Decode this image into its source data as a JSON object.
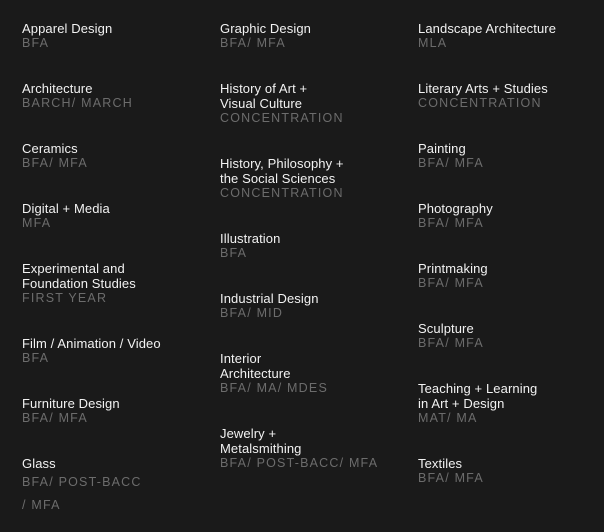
{
  "programs": {
    "col1": [
      {
        "name": "Apparel Design",
        "degree": "BFA"
      },
      {
        "name": "Architecture",
        "degree": "BARCH/ MARCH"
      },
      {
        "name": "Ceramics",
        "degree": "BFA/ MFA"
      },
      {
        "name": "Digital + Media",
        "degree": "MFA"
      },
      {
        "name": "Experimental and\nFoundation Studies",
        "degree": "FIRST YEAR"
      },
      {
        "name": "Film / Animation / Video",
        "degree": "BFA"
      },
      {
        "name": "Furniture Design",
        "degree": "BFA/ MFA"
      },
      {
        "name": "Glass",
        "degree": "BFA/ POST-BACC\n/ MFA"
      }
    ],
    "col2": [
      {
        "name": "Graphic Design",
        "degree": "BFA/ MFA"
      },
      {
        "name": "History of Art +\nVisual Culture",
        "degree": "CONCENTRATION"
      },
      {
        "name": "History, Philosophy +\nthe Social Sciences",
        "degree": "CONCENTRATION"
      },
      {
        "name": "Illustration",
        "degree": "BFA"
      },
      {
        "name": "Industrial Design",
        "degree": "BFA/ MID"
      },
      {
        "name": "Interior\nArchitecture",
        "degree": "BFA/ MA/ MDES"
      },
      {
        "name": "Jewelry +\nMetalsmithing",
        "degree": "BFA/ POST-BACC/ MFA"
      }
    ],
    "col3": [
      {
        "name": "Landscape Architecture",
        "degree": "MLA"
      },
      {
        "name": "Literary Arts + Studies",
        "degree": "CONCENTRATION"
      },
      {
        "name": "Painting",
        "degree": "BFA/ MFA"
      },
      {
        "name": "Photography",
        "degree": "BFA/ MFA"
      },
      {
        "name": "Printmaking",
        "degree": "BFA/ MFA"
      },
      {
        "name": "Sculpture",
        "degree": "BFA/ MFA"
      },
      {
        "name": "Teaching + Learning\nin Art + Design",
        "degree": "MAT/ MA"
      },
      {
        "name": "Textiles",
        "degree": "BFA/ MFA"
      }
    ]
  },
  "colors": {
    "background": "#1a1a1a",
    "name": "#f2f2f2",
    "degree": "#6c6c6c"
  }
}
